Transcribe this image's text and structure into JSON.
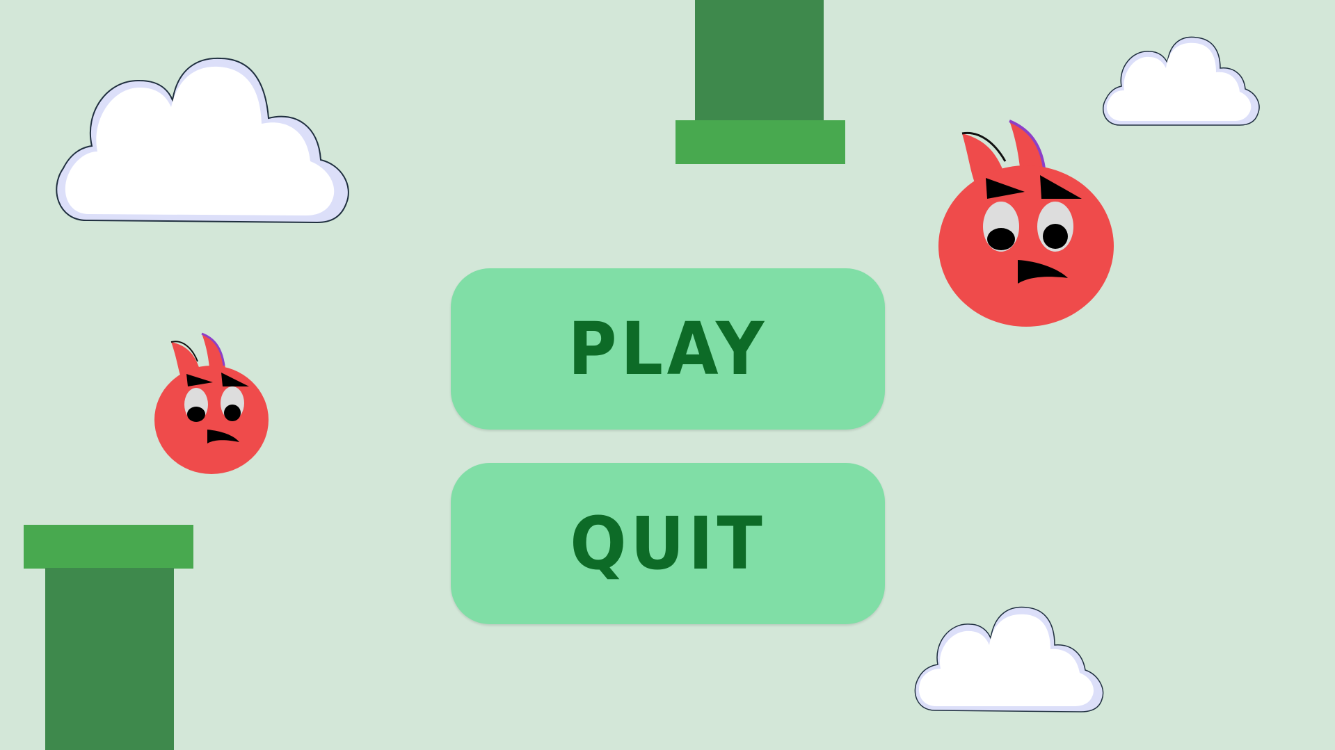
{
  "game": {
    "menu": {
      "play_label": "PLAY",
      "quit_label": "QUIT"
    }
  },
  "colors": {
    "background": "#d3e7d8",
    "button_fill": "#80dea6",
    "button_text": "#0d6b27",
    "pipe_body": "#3e894c",
    "pipe_cap": "#48a94f",
    "enemy_body": "#ef4b4b",
    "enemy_horn_accent": "#8c3fc7",
    "cloud_fill": "#ffffff",
    "cloud_shadow": "#dcdff9",
    "cloud_outline": "#1f2f3f"
  },
  "sprites": {
    "clouds": [
      "cloud",
      "cloud",
      "cloud"
    ],
    "pipes": [
      "pipe-top",
      "pipe-bottom"
    ],
    "enemies": [
      "horned-red-ball",
      "horned-red-ball"
    ]
  }
}
